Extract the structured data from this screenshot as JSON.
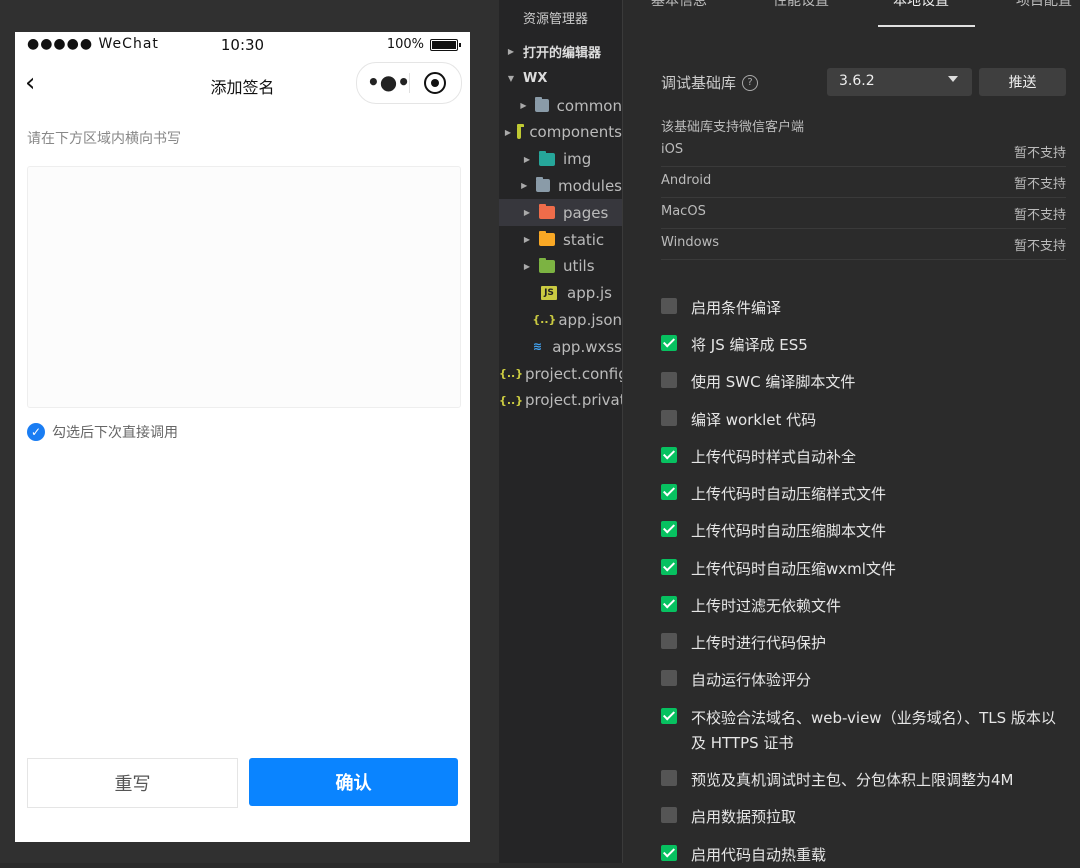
{
  "simulator": {
    "status": {
      "signal": "●●●●● WeChat",
      "time": "10:30",
      "battery": "100%"
    },
    "nav": {
      "back_glyph": "‹",
      "title": "添加签名",
      "more_glyph": "•●•"
    },
    "hint": "请在下方区域内横向书写",
    "remember_label": "勾选后下次直接调用",
    "remember_checked": true,
    "rewrite_label": "重写",
    "confirm_label": "确认",
    "confirm_color": "#0a84ff"
  },
  "explorer": {
    "title": "资源管理器",
    "sections": [
      {
        "label": "打开的编辑器"
      },
      {
        "label": "WX"
      }
    ],
    "items": [
      {
        "label": "common",
        "type": "folder",
        "icon": "folder-icon",
        "color": "#8a9ba8"
      },
      {
        "label": "components",
        "type": "folder",
        "icon": "components-folder-icon",
        "color": "#c0ca33"
      },
      {
        "label": "img",
        "type": "folder",
        "icon": "image-folder-icon",
        "color": "#26a69a"
      },
      {
        "label": "modules",
        "type": "folder",
        "icon": "folder-icon",
        "color": "#8a9ba8"
      },
      {
        "label": "pages",
        "type": "folder",
        "icon": "pages-folder-icon",
        "color": "#ef6c4a",
        "active": true
      },
      {
        "label": "static",
        "type": "folder",
        "icon": "static-folder-icon",
        "color": "#f9a825"
      },
      {
        "label": "utils",
        "type": "folder",
        "icon": "utils-folder-icon",
        "color": "#7cb342"
      },
      {
        "label": "app.js",
        "type": "file",
        "icon": "js-file-icon",
        "glyph": "JS",
        "color": "#cbcb41"
      },
      {
        "label": "app.json",
        "type": "file",
        "icon": "json-file-icon",
        "glyph": "{..}",
        "color": "#cbcb41"
      },
      {
        "label": "app.wxss",
        "type": "file",
        "icon": "css-file-icon",
        "glyph": "≋",
        "color": "#42a5f5"
      },
      {
        "label": "project.config.json",
        "type": "file",
        "icon": "json-file-icon",
        "glyph": "{..}",
        "color": "#cbcb41"
      },
      {
        "label": "project.private.config.json",
        "type": "file",
        "icon": "json-file-icon",
        "glyph": "{..}",
        "color": "#cbcb41"
      }
    ]
  },
  "settings": {
    "tabs": [
      "基本信息",
      "性能设置",
      "本地设置",
      "项目配置"
    ],
    "active_tab": 2,
    "base_lib_label": "调试基础库",
    "base_lib_value": "3.6.2",
    "push_label": "推送",
    "support_title": "该基础库支持微信客户端",
    "support_rows": [
      {
        "os": "iOS",
        "status": "暂不支持"
      },
      {
        "os": "Android",
        "status": "暂不支持"
      },
      {
        "os": "MacOS",
        "status": "暂不支持"
      },
      {
        "os": "Windows",
        "status": "暂不支持"
      }
    ],
    "options": [
      {
        "label": "启用条件编译",
        "checked": false
      },
      {
        "label": "将 JS 编译成 ES5",
        "checked": true
      },
      {
        "label": "使用 SWC 编译脚本文件",
        "checked": false
      },
      {
        "label": "编译 worklet 代码",
        "checked": false
      },
      {
        "label": "上传代码时样式自动补全",
        "checked": true
      },
      {
        "label": "上传代码时自动压缩样式文件",
        "checked": true
      },
      {
        "label": "上传代码时自动压缩脚本文件",
        "checked": true
      },
      {
        "label": "上传代码时自动压缩wxml文件",
        "checked": true
      },
      {
        "label": "上传时过滤无依赖文件",
        "checked": true
      },
      {
        "label": "上传时进行代码保护",
        "checked": false
      },
      {
        "label": "自动运行体验评分",
        "checked": false
      },
      {
        "label": "不校验合法域名、web-view（业务域名）、TLS 版本以及 HTTPS 证书",
        "checked": true
      },
      {
        "label": "预览及真机调试时主包、分包体积上限调整为4M",
        "checked": false
      },
      {
        "label": "启用数据预拉取",
        "checked": false
      },
      {
        "label": "启用代码自动热重载",
        "checked": true
      }
    ],
    "accent_color": "#07c160"
  }
}
